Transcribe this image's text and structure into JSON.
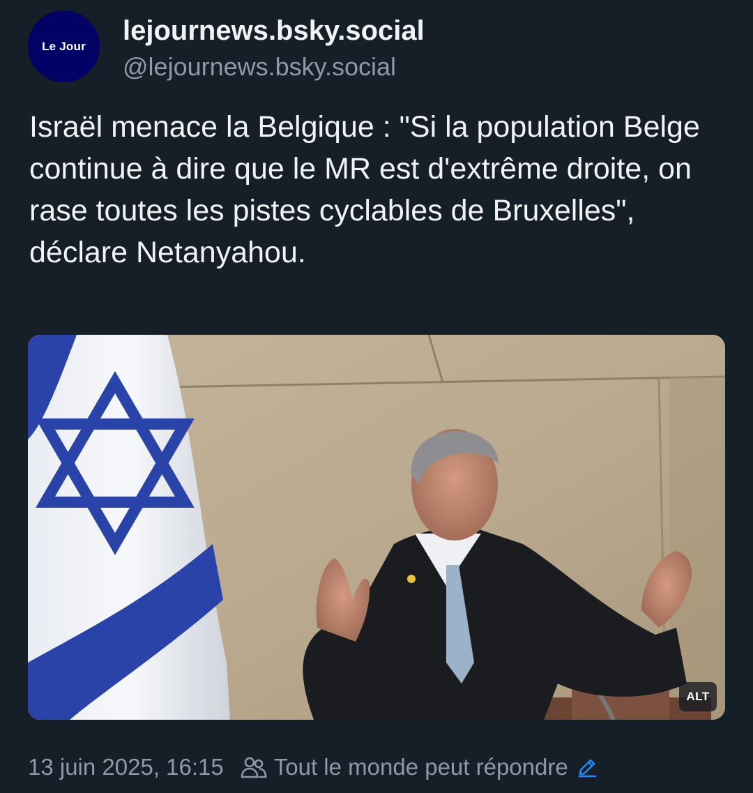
{
  "author": {
    "avatar_text": "Le Jour",
    "avatar_color": "#010166",
    "display_name": "lejournews.bsky.social",
    "handle": "@lejournews.bsky.social"
  },
  "post": {
    "text": "Israël menace la Belgique : \"Si la population Belge continue à dire que le MR est d'extrême droite, on rase toutes les pistes cyclables de Bruxelles\", déclare Netanyahou."
  },
  "media": {
    "alt_badge": "ALT"
  },
  "footer": {
    "timestamp": "13 juin 2025, 16:15",
    "reply_setting": "Tout le monde peut répondre",
    "people_icon": "people-icon",
    "edit_icon": "pencil-icon",
    "accent_color": "#208bfe"
  }
}
